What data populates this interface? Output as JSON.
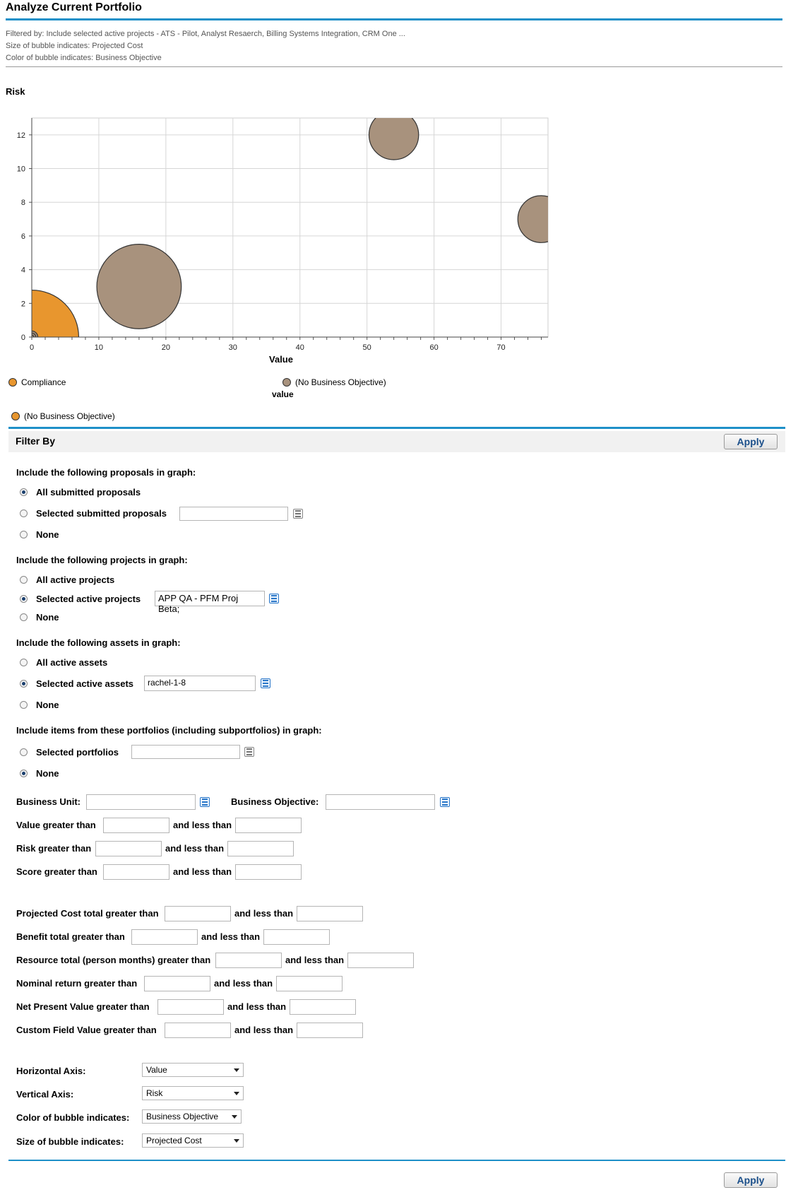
{
  "page": {
    "title": "Analyze Current Portfolio",
    "filtered_by": "Filtered by: Include selected active projects - ATS - Pilot, Analyst Resaerch, Billing Systems Integration, CRM One ...",
    "size_indicates": "Size of bubble indicates: Projected Cost",
    "color_indicates": "Color of bubble indicates: Business Objective"
  },
  "chart_data": {
    "type": "scatter",
    "title": "",
    "xlabel": "Value",
    "ylabel": "Risk",
    "xlim": [
      0,
      77
    ],
    "ylim": [
      0,
      13
    ],
    "x_ticks": [
      "0",
      "10",
      "20",
      "30",
      "40",
      "50",
      "60",
      "70"
    ],
    "y_ticks": [
      "0",
      "2",
      "4",
      "6",
      "8",
      "10",
      "12"
    ],
    "grid": true,
    "colors": {
      "orange": "#e8962e",
      "grey": "#a8927d"
    },
    "series": [
      {
        "name": "Compliance",
        "color": "#e8962e",
        "points": [
          {
            "x": 0,
            "y": 0,
            "size": 7
          }
        ]
      },
      {
        "name": "(No Business Objective)",
        "color": "#a8927d",
        "points": [
          {
            "x": 16,
            "y": 3,
            "size": 6.3
          },
          {
            "x": 54,
            "y": 12,
            "size": 3.7
          },
          {
            "x": 76,
            "y": 7,
            "size": 3.5
          },
          {
            "x": 0,
            "y": 0,
            "size": 0.9
          },
          {
            "x": 0,
            "y": 0,
            "size": 0.6
          },
          {
            "x": 0,
            "y": 0,
            "size": 0.3
          }
        ]
      }
    ],
    "legend": {
      "item_1": "Compliance",
      "item_2": "(No Business Objective)",
      "group_label": "value",
      "item_3": "(No Business Objective)"
    }
  },
  "filter": {
    "title": "Filter By",
    "apply_label": "Apply",
    "proposals": {
      "heading": "Include the following proposals in graph:",
      "all": "All submitted proposals",
      "selected": "Selected submitted proposals",
      "none": "None",
      "selected_value": ""
    },
    "projects": {
      "heading": "Include the following projects in graph:",
      "all": "All active projects",
      "selected": "Selected active projects",
      "none": "None",
      "selected_value": "APP QA - PFM Proj Beta;"
    },
    "assets": {
      "heading": "Include the following assets in graph:",
      "all": "All active assets",
      "selected": "Selected active assets",
      "none": "None",
      "selected_value": "rachel-1-8"
    },
    "portfolios": {
      "heading": "Include items from these portfolios (including subportfolios) in graph:",
      "selected": "Selected portfolios",
      "none": "None",
      "selected_value": ""
    },
    "business_unit": "Business Unit:",
    "business_objective": "Business Objective:",
    "and_less_than": "and less than",
    "ranges": {
      "value": "Value greater than",
      "risk": "Risk greater than",
      "score": "Score greater than",
      "projected_cost": "Projected Cost total greater than",
      "benefit": "Benefit total greater than",
      "resource": "Resource total (person months) greater than",
      "nominal_return": "Nominal return greater than",
      "npv": "Net Present Value greater than",
      "custom_field": "Custom Field Value greater than"
    },
    "axes": {
      "horizontal_label": "Horizontal Axis:",
      "horizontal_value": "Value",
      "vertical_label": "Vertical Axis:",
      "vertical_value": "Risk",
      "color_label": "Color of bubble indicates:",
      "color_value": "Business Objective",
      "size_label": "Size of bubble indicates:",
      "size_value": "Projected Cost"
    }
  }
}
